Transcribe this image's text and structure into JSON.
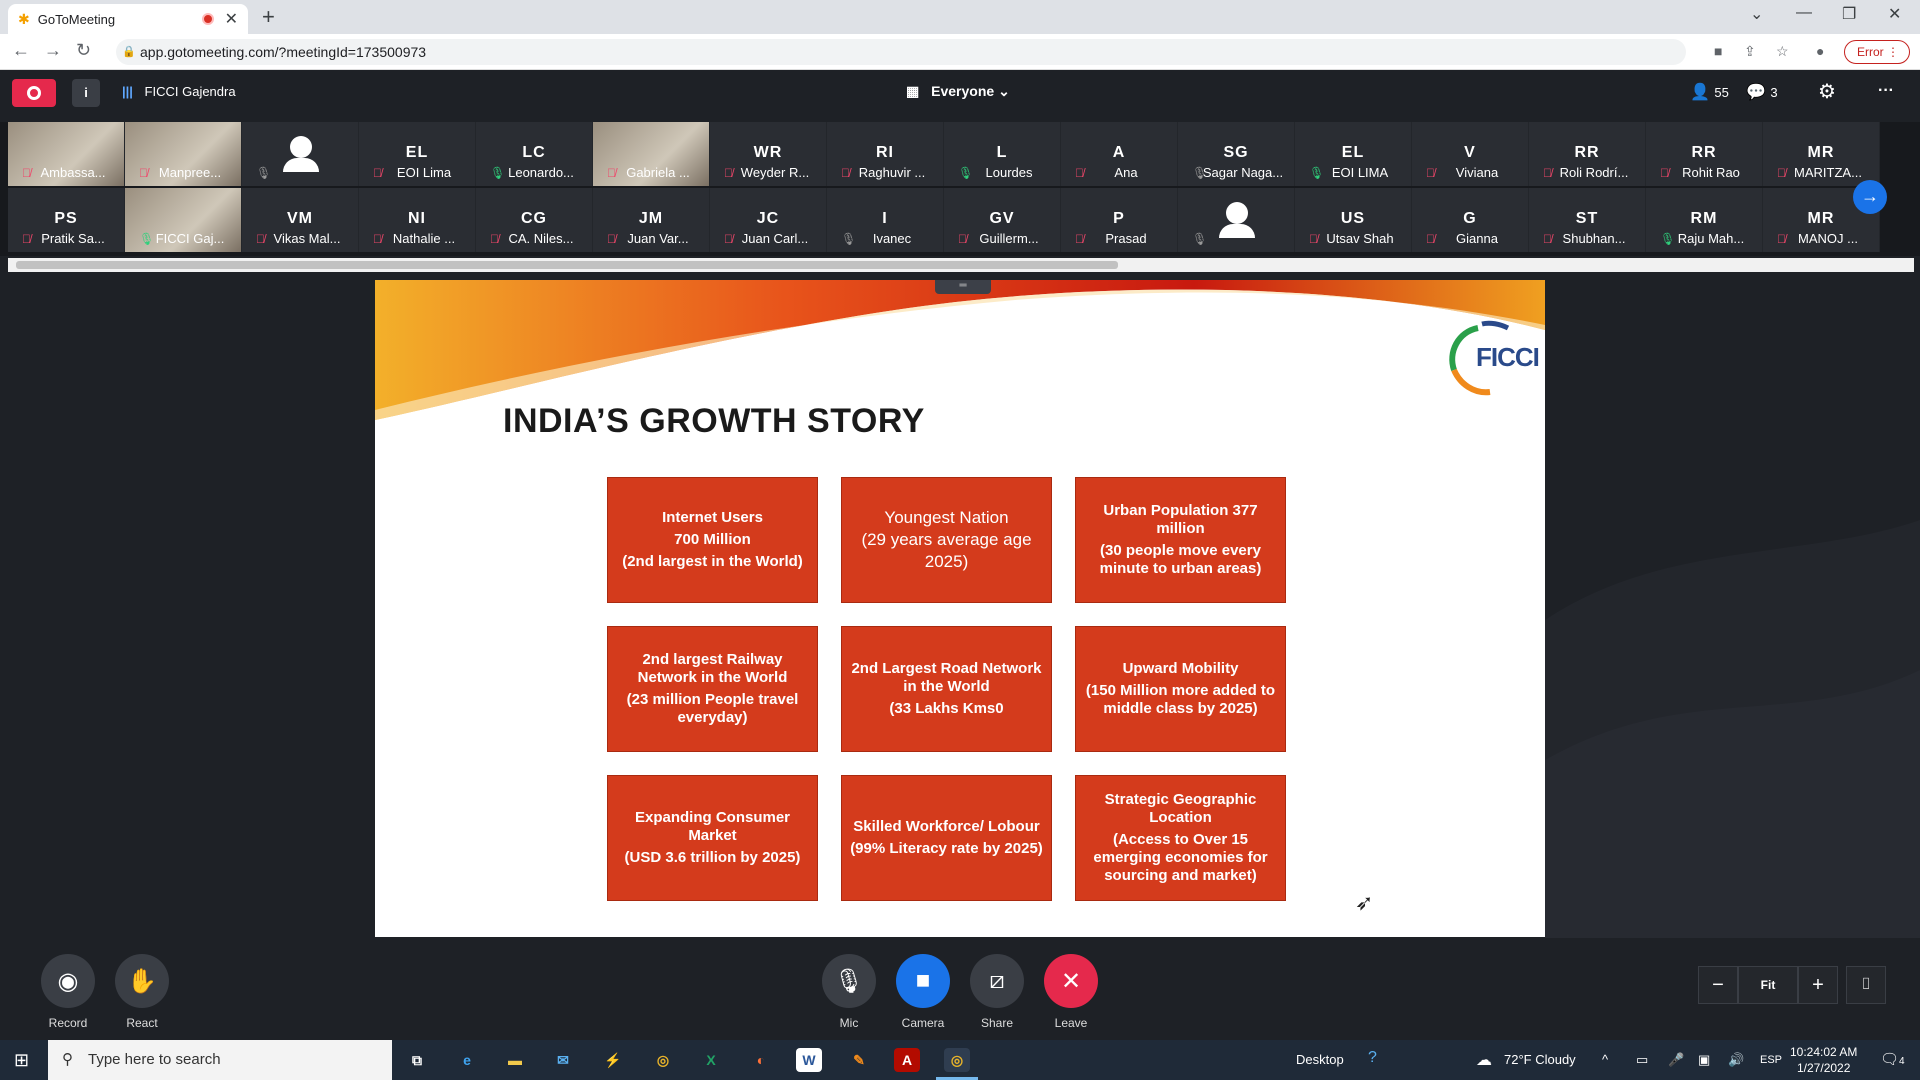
{
  "browser": {
    "tab_title": "GoToMeeting",
    "url": "app.gotomeeting.com/?meetingId=173500973",
    "error_label": "Error"
  },
  "meeting": {
    "presenter": "FICCI Gajendra",
    "audience": "Everyone",
    "participant_count": "55",
    "chat_count": "3"
  },
  "participants_row1": [
    {
      "initials": "",
      "name": "Ambassa...",
      "mic": "muted",
      "video": true
    },
    {
      "initials": "",
      "name": "Manpree...",
      "mic": "muted",
      "video": true
    },
    {
      "initials": "",
      "name": "",
      "mic": "idle",
      "avatar": true
    },
    {
      "initials": "EL",
      "name": "EOI Lima",
      "mic": "muted"
    },
    {
      "initials": "LC",
      "name": "Leonardo...",
      "mic": "on"
    },
    {
      "initials": "",
      "name": "Gabriela ...",
      "mic": "muted",
      "video": true
    },
    {
      "initials": "WR",
      "name": "Weyder R...",
      "mic": "muted"
    },
    {
      "initials": "RI",
      "name": "Raghuvir ...",
      "mic": "muted"
    },
    {
      "initials": "L",
      "name": "Lourdes",
      "mic": "on"
    },
    {
      "initials": "A",
      "name": "Ana",
      "mic": "muted"
    },
    {
      "initials": "SG",
      "name": "Sagar Naga...",
      "mic": "idle"
    },
    {
      "initials": "EL",
      "name": "EOI LIMA",
      "mic": "on"
    },
    {
      "initials": "V",
      "name": "Viviana",
      "mic": "muted"
    },
    {
      "initials": "RR",
      "name": "Roli Rodrí...",
      "mic": "muted"
    },
    {
      "initials": "RR",
      "name": "Rohit Rao",
      "mic": "muted"
    },
    {
      "initials": "MR",
      "name": "MARITZA...",
      "mic": "muted"
    }
  ],
  "participants_row2": [
    {
      "initials": "PS",
      "name": "Pratik Sa...",
      "mic": "muted"
    },
    {
      "initials": "",
      "name": "FICCI Gaj...",
      "mic": "on",
      "video": true
    },
    {
      "initials": "VM",
      "name": "Vikas Mal...",
      "mic": "muted"
    },
    {
      "initials": "NI",
      "name": "Nathalie ...",
      "mic": "muted"
    },
    {
      "initials": "CG",
      "name": "CA. Niles...",
      "mic": "muted"
    },
    {
      "initials": "JM",
      "name": "Juan Var...",
      "mic": "muted"
    },
    {
      "initials": "JC",
      "name": "Juan Carl...",
      "mic": "muted"
    },
    {
      "initials": "I",
      "name": "Ivanec",
      "mic": "idle"
    },
    {
      "initials": "GV",
      "name": "Guillerm...",
      "mic": "muted"
    },
    {
      "initials": "P",
      "name": "Prasad",
      "mic": "muted"
    },
    {
      "initials": "",
      "name": "",
      "mic": "idle",
      "avatar": true
    },
    {
      "initials": "US",
      "name": "Utsav Shah",
      "mic": "muted"
    },
    {
      "initials": "G",
      "name": "Gianna",
      "mic": "muted"
    },
    {
      "initials": "ST",
      "name": "Shubhan...",
      "mic": "muted"
    },
    {
      "initials": "RM",
      "name": "Raju Mah...",
      "mic": "on"
    },
    {
      "initials": "MR",
      "name": "MANOJ ...",
      "mic": "muted"
    }
  ],
  "slide": {
    "title": "INDIA’S GROWTH STORY",
    "logo_text": "FICCI",
    "boxes": [
      {
        "l1": "Internet Users",
        "l2": "700 Million",
        "l3": "(2nd largest in the World)"
      },
      {
        "l1": "Youngest Nation",
        "l2": "(29 years average age",
        "l3": "2025)"
      },
      {
        "l1": "Urban Population 377 million",
        "l2": "(30 people move every minute to urban areas)",
        "l3": ""
      },
      {
        "l1": "2nd largest Railway Network in the World",
        "l2": "(23 million People travel everyday)",
        "l3": ""
      },
      {
        "l1": "2nd Largest Road Network in the World",
        "l2": "(33 Lakhs Kms0",
        "l3": ""
      },
      {
        "l1": "Upward Mobility",
        "l2": "(150 Million more added to middle class by 2025)",
        "l3": ""
      },
      {
        "l1": "Expanding Consumer Market",
        "l2": "(USD 3.6 trillion by 2025)",
        "l3": ""
      },
      {
        "l1": "Skilled Workforce/ Lobour",
        "l2": "(99% Literacy rate by 2025)",
        "l3": ""
      },
      {
        "l1": "Strategic Geographic Location",
        "l2": "(Access to Over 15 emerging economies for sourcing and market)",
        "l3": ""
      }
    ]
  },
  "controls": {
    "record": "Record",
    "react": "React",
    "mic": "Mic",
    "camera": "Camera",
    "share": "Share",
    "leave": "Leave",
    "fit": "Fit"
  },
  "taskbar": {
    "search_placeholder": "Type here to search",
    "desktop_label": "Desktop",
    "weather": "72°F  Cloudy",
    "lang": "ESP",
    "time": "10:24:02 AM",
    "date": "1/27/2022",
    "notif_count": "4"
  }
}
